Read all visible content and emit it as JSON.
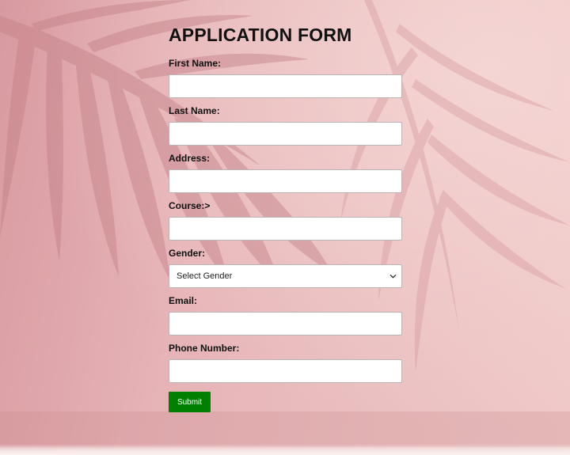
{
  "form": {
    "title": "APPLICATION FORM",
    "fields": {
      "first_name": {
        "label": "First Name:",
        "value": ""
      },
      "last_name": {
        "label": "Last Name:",
        "value": ""
      },
      "address": {
        "label": "Address:",
        "value": ""
      },
      "course": {
        "label": "Course:>",
        "value": ""
      },
      "gender": {
        "label": "Gender:",
        "selected": "Select Gender"
      },
      "email": {
        "label": "Email:",
        "value": ""
      },
      "phone": {
        "label": "Phone Number:",
        "value": ""
      }
    },
    "submit_label": "Submit"
  },
  "colors": {
    "submit_bg": "#008000",
    "background_tint": "#e6b3b6"
  },
  "icons": {
    "select_arrow": "chevron-down-icon"
  }
}
